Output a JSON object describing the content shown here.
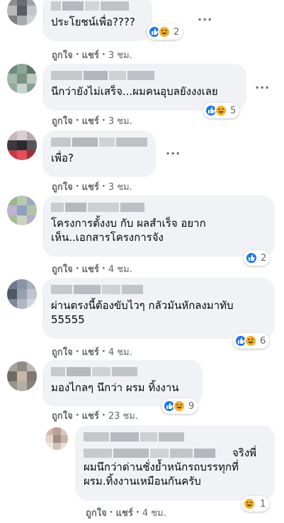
{
  "comments": [
    {
      "text": "ประโยชน์เพื่อ????",
      "like": "ถูกใจ",
      "reply": "แชร์",
      "time": "3 ชม.",
      "reaction_count": "2",
      "reactions": [
        "like-icon",
        "haha-icon"
      ]
    },
    {
      "text": "นีกว่ายังไม่เสร็จ...ผมคนอุบลยังงงเลย",
      "like": "ถูกใจ",
      "reply": "แชร์",
      "time": "3 ชม.",
      "reaction_count": "5",
      "reactions": [
        "like-icon",
        "haha-icon"
      ]
    },
    {
      "text": "เพื่อ?",
      "like": "ถูกใจ",
      "reply": "แชร์",
      "time": "3 ชม."
    },
    {
      "text": "โครงการตั้งงบ กับ ผลสำเร็จ อยาก\nเห็น..เอกสารโครงการจัง",
      "like": "ถูกใจ",
      "reply": "แชร์",
      "time": "4 ชม.",
      "reaction_count": "2",
      "reactions": [
        "like-icon"
      ]
    },
    {
      "text": "ผ่านตรงนี้ต้องขับไวๆ กลัวมันหักลงมาทับ\n55555",
      "like": "ถูกใจ",
      "reply": "แชร์",
      "time": "4 ชม.",
      "reaction_count": "6",
      "reactions": [
        "like-icon",
        "haha-icon"
      ]
    },
    {
      "text": "มองไกลๆ นึกว่า ผรม ทิ้งงาน",
      "like": "ถูกใจ",
      "reply": "แชร์",
      "time": "23 ชม.",
      "reaction_count": "9",
      "reactions": [
        "like-icon",
        "haha-icon"
      ]
    }
  ],
  "reply": {
    "name_suffix": "จริงพี่",
    "text": "ผมนึกว่าด่านชั่งย้ำหนักรถบรรทุกที่\nผรม.ทิ้งงานเหมือนกันครับ",
    "like": "ถูกใจ",
    "reply_label": "แชร์",
    "time": "4 ชม.",
    "reaction_count": "1",
    "reactions": [
      "haha-icon"
    ]
  },
  "more_options": "···",
  "separator": "·",
  "colors": {
    "bubble": "#f0f2f5",
    "action_text": "#65676b",
    "like_blue": "#1877f2",
    "haha_yellow": "#f7b125"
  }
}
